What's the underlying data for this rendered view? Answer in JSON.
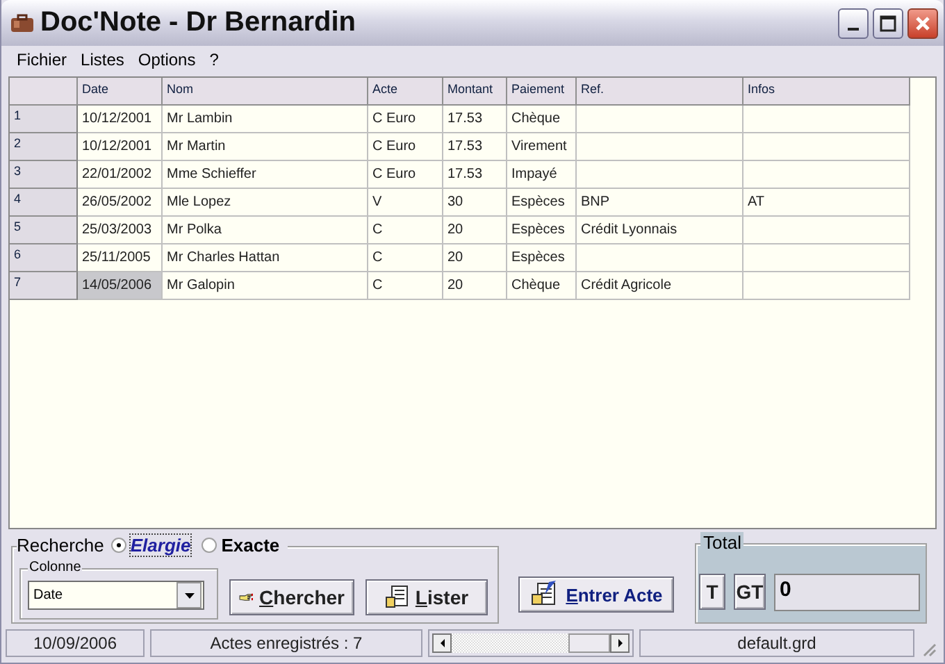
{
  "window": {
    "title": "Doc'Note - Dr Bernardin"
  },
  "menu": [
    "Fichier",
    "Listes",
    "Options",
    "?"
  ],
  "table": {
    "columns": [
      "Date",
      "Nom",
      "Acte",
      "Montant",
      "Paiement",
      "Ref.",
      "Infos"
    ],
    "rows": [
      {
        "number": "1",
        "selected": false,
        "cells": [
          "10/12/2001",
          "Mr Lambin",
          "C Euro",
          "17.53",
          "Chèque",
          "",
          ""
        ]
      },
      {
        "number": "2",
        "selected": false,
        "cells": [
          "10/12/2001",
          "Mr Martin",
          "C Euro",
          "17.53",
          "Virement",
          "",
          ""
        ]
      },
      {
        "number": "3",
        "selected": false,
        "cells": [
          "22/01/2002",
          "Mme Schieffer",
          "C Euro",
          "17.53",
          "Impayé",
          "",
          ""
        ]
      },
      {
        "number": "4",
        "selected": false,
        "cells": [
          "26/05/2002",
          "Mle Lopez",
          "V",
          "30",
          "Espèces",
          "BNP",
          "AT"
        ]
      },
      {
        "number": "5",
        "selected": false,
        "cells": [
          "25/03/2003",
          "Mr Polka",
          "C",
          "20",
          "Espèces",
          "Crédit Lyonnais",
          ""
        ]
      },
      {
        "number": "6",
        "selected": false,
        "cells": [
          "25/11/2005",
          "Mr Charles Hattan",
          "C",
          "20",
          "Espèces",
          "",
          ""
        ]
      },
      {
        "number": "7",
        "selected": true,
        "cells": [
          "14/05/2006",
          "Mr Galopin",
          "C",
          "20",
          "Chèque",
          "Crédit Agricole",
          ""
        ]
      }
    ]
  },
  "search": {
    "title": "Recherche",
    "modes": [
      {
        "label": "Elargie",
        "selected": true
      },
      {
        "label": "Exacte",
        "selected": false
      }
    ],
    "column_group": {
      "title": "Colonne",
      "value": "Date"
    },
    "buttons": [
      "Chercher",
      "Lister"
    ]
  },
  "enter_button": "Entrer Acte",
  "total": {
    "title": "Total",
    "buttons": [
      "T",
      "GT"
    ],
    "value": "0"
  },
  "status_bar": {
    "date": "10/09/2006",
    "count": "Actes enregistrés : 7",
    "file": "default.grd"
  }
}
